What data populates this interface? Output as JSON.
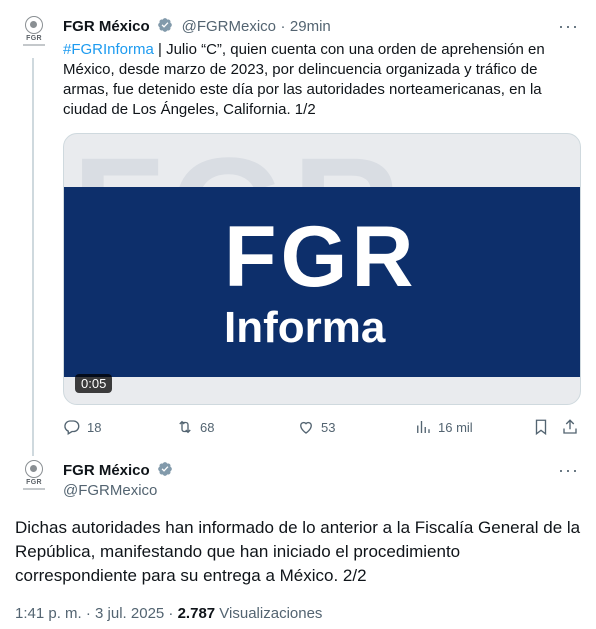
{
  "tweet1": {
    "display_name": "FGR México",
    "handle": "@FGRMexico",
    "separator": "·",
    "time": "29min",
    "hashtag": "#FGRInforma",
    "body": " | Julio “C”, quien cuenta con una orden de aprehensión en México, desde marzo de 2023, por delincuencia organizada y tráfico de armas, fue detenido este día por las autoridades norteamericanas, en la ciudad de Los Ángeles, California. 1/2",
    "media": {
      "headline": "FGR",
      "subline": "Informa",
      "duration": "0:05"
    },
    "actions": {
      "replies": "18",
      "reposts": "68",
      "likes": "53",
      "views": "16 mil"
    }
  },
  "tweet2": {
    "display_name": "FGR México",
    "handle": "@FGRMexico",
    "body": "Dichas autoridades han informado de lo anterior a la Fiscalía General de la República, manifestando que han iniciado el procedimiento correspondiente para su entrega a México. 2/2",
    "timestamp": "1:41 p. m. · 3 jul. 2025 · ",
    "view_count": "2.787",
    "views_label": " Visualizaciones"
  },
  "avatar_text": "FGR",
  "more_glyph": "···",
  "colors": {
    "accent": "#1d9bf0",
    "muted": "#536471",
    "media_band": "#0d2f6b"
  }
}
